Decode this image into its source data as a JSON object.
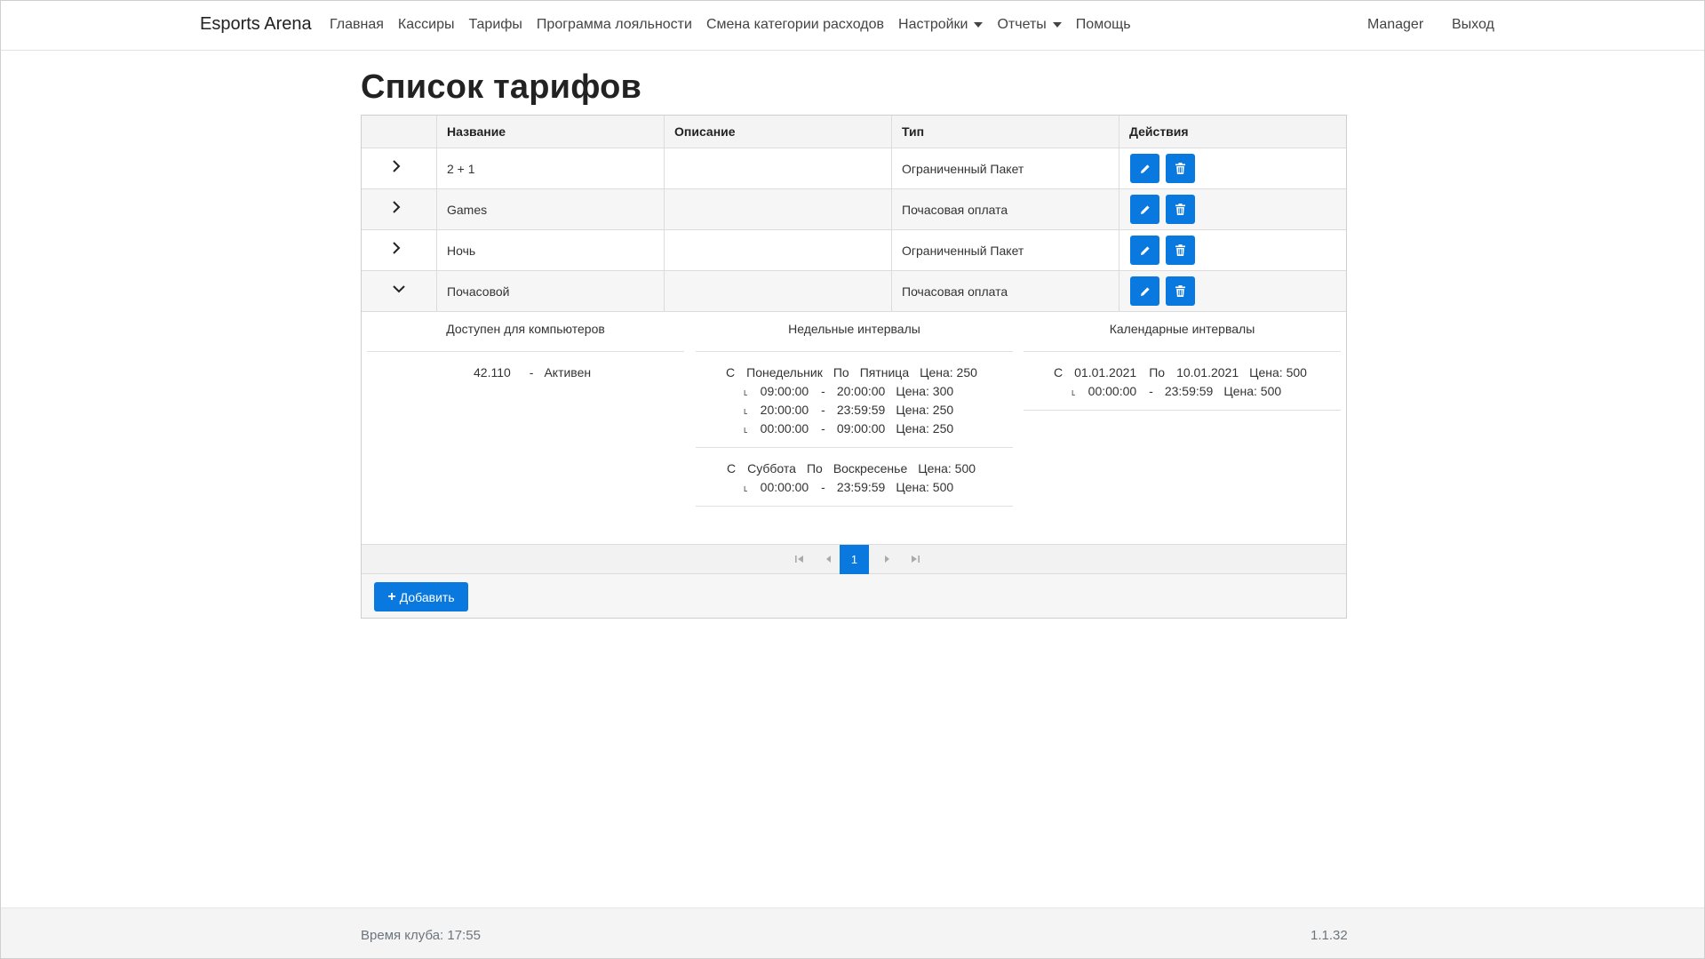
{
  "navbar": {
    "brand": "Esports Arena",
    "links": [
      {
        "label": "Главная"
      },
      {
        "label": "Кассиры"
      },
      {
        "label": "Тарифы"
      },
      {
        "label": "Программа лояльности"
      },
      {
        "label": "Смена категории расходов"
      },
      {
        "label": "Настройки",
        "dropdown": true
      },
      {
        "label": "Отчеты",
        "dropdown": true
      },
      {
        "label": "Помощь"
      }
    ],
    "user": "Manager",
    "logout": "Выход"
  },
  "page": {
    "title": "Список тарифов"
  },
  "table": {
    "columns": [
      "Название",
      "Описание",
      "Тип",
      "Действия"
    ],
    "rows": [
      {
        "name": "2 + 1",
        "description": "",
        "type": "Ограниченный Пакет",
        "expanded": false
      },
      {
        "name": "Games",
        "description": "",
        "type": "Почасовая оплата",
        "expanded": false
      },
      {
        "name": "Ночь",
        "description": "",
        "type": "Ограниченный Пакет",
        "expanded": false
      },
      {
        "name": "Почасовой",
        "description": "",
        "type": "Почасовая оплата",
        "expanded": true
      }
    ]
  },
  "detail": {
    "computers_title": "Доступен для компьютеров",
    "computers": [
      {
        "id": "42.110",
        "sep": "-",
        "status": "Активен"
      }
    ],
    "weekly_title": "Недельные интервалы",
    "weekly": [
      {
        "from_label": "С",
        "from": "Понедельник",
        "to_label": "По",
        "to": "Пятница",
        "price": "Цена: 250",
        "intervals": [
          {
            "start": "09:00:00",
            "sep": "-",
            "end": "20:00:00",
            "price": "Цена: 300"
          },
          {
            "start": "20:00:00",
            "sep": "-",
            "end": "23:59:59",
            "price": "Цена: 250"
          },
          {
            "start": "00:00:00",
            "sep": "-",
            "end": "09:00:00",
            "price": "Цена: 250"
          }
        ]
      },
      {
        "from_label": "С",
        "from": "Суббота",
        "to_label": "По",
        "to": "Воскресенье",
        "price": "Цена: 500",
        "intervals": [
          {
            "start": "00:00:00",
            "sep": "-",
            "end": "23:59:59",
            "price": "Цена: 500"
          }
        ]
      }
    ],
    "calendar_title": "Календарные интервалы",
    "calendar": [
      {
        "from_label": "С",
        "from": "01.01.2021",
        "to_label": "По",
        "to": "10.01.2021",
        "price": "Цена: 500",
        "intervals": [
          {
            "start": "00:00:00",
            "sep": "-",
            "end": "23:59:59",
            "price": "Цена: 500"
          }
        ]
      }
    ]
  },
  "pager": {
    "current": "1"
  },
  "toolbar": {
    "add_label": "Добавить"
  },
  "footer": {
    "club_time": "Время клуба: 17:55",
    "version": "1.1.32"
  },
  "colors": {
    "primary": "#0a79df",
    "header_bg": "#f4f4f4",
    "footer_bg": "#f4f4f4"
  }
}
